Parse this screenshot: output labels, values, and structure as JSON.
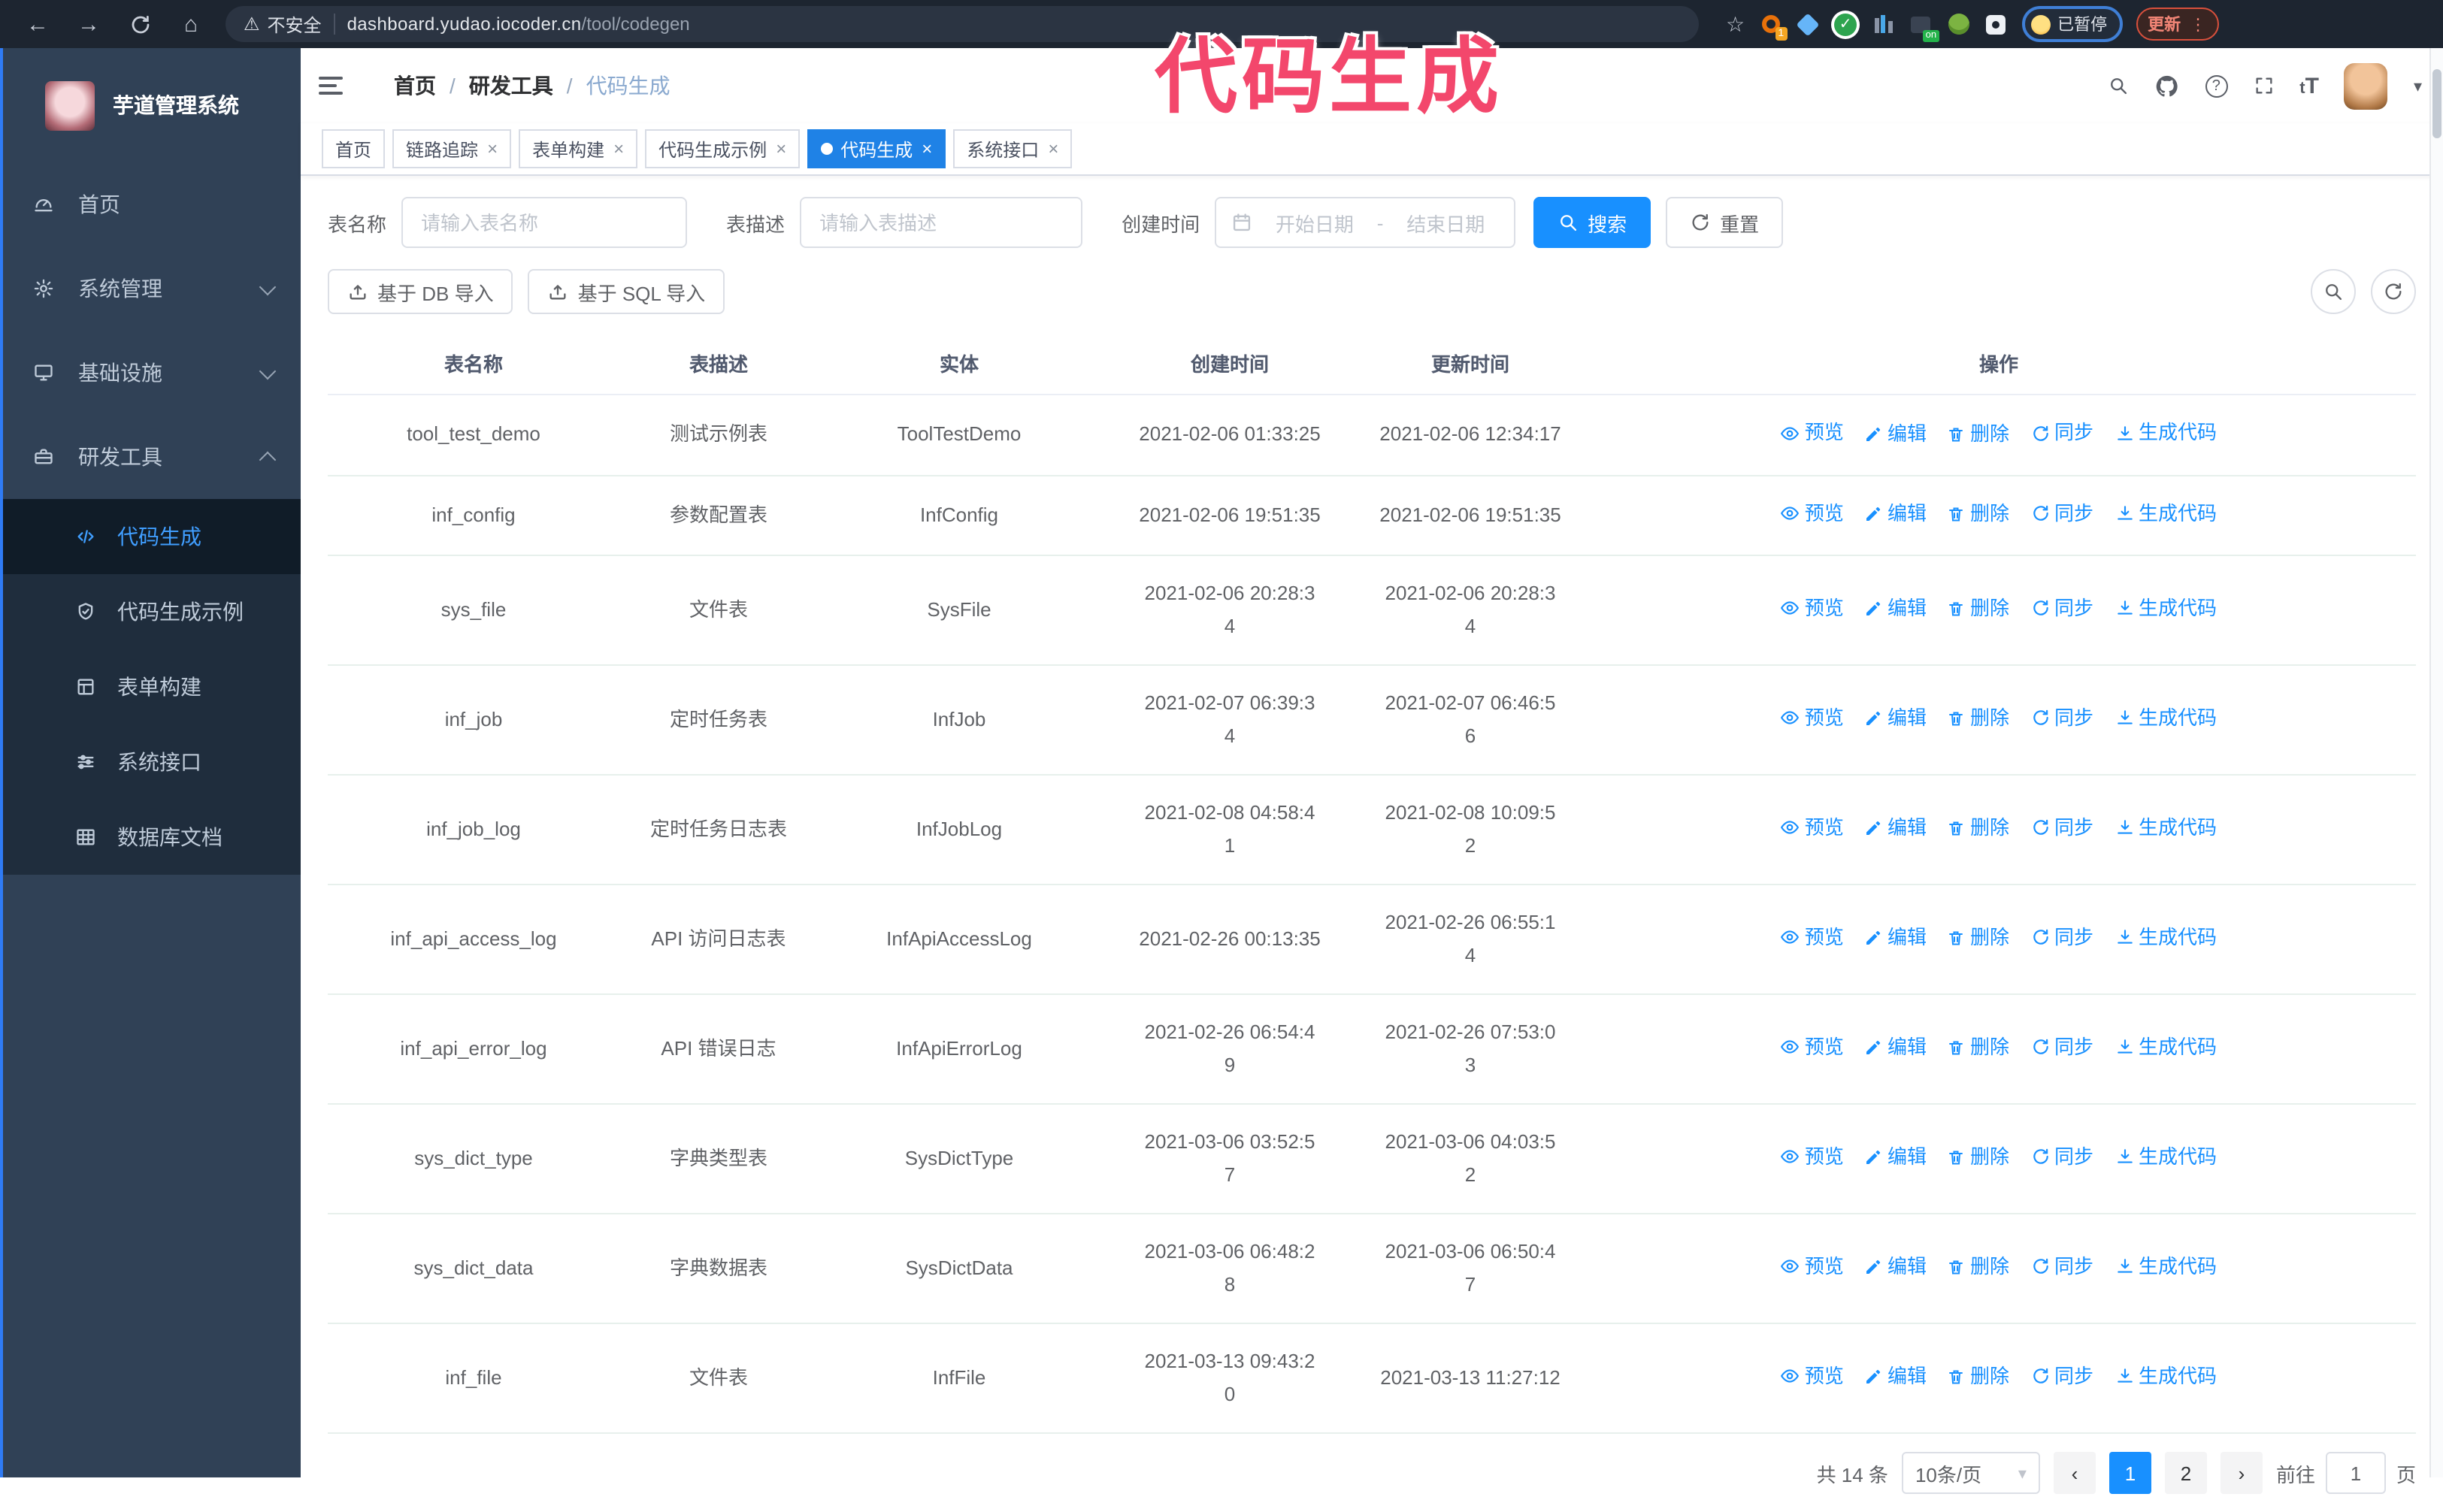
{
  "colors": {
    "accent": "#1890ff",
    "tag_active": "#1f82e6",
    "sidebar_bg": "#304156",
    "submenu_bg": "#1f2d3d",
    "annotation": "#f3476c",
    "chrome_bg": "#1d2530"
  },
  "annotation": {
    "text": "代码生成"
  },
  "browser": {
    "security_label": "不安全",
    "url_domain": "dashboard.yudao.iocoder.cn",
    "url_path": "/tool/codegen",
    "ext_badge_count": "1",
    "ext_on_label": "on",
    "paused_badge": "已暂停",
    "update_button": "更新",
    "menu_dots": "⋮"
  },
  "sidebar": {
    "title": "芋道管理系统",
    "items": [
      {
        "label": "首页",
        "icon": "dashboard-icon",
        "expand": ""
      },
      {
        "label": "系统管理",
        "icon": "gear-icon",
        "expand": "down"
      },
      {
        "label": "基础设施",
        "icon": "monitor-icon",
        "expand": "down"
      },
      {
        "label": "研发工具",
        "icon": "toolbox-icon",
        "expand": "up"
      }
    ],
    "subitems": [
      {
        "label": "代码生成",
        "icon": "code-icon",
        "active": true
      },
      {
        "label": "代码生成示例",
        "icon": "shield-check-icon",
        "active": false
      },
      {
        "label": "表单构建",
        "icon": "form-icon",
        "active": false
      },
      {
        "label": "系统接口",
        "icon": "sliders-icon",
        "active": false
      },
      {
        "label": "数据库文档",
        "icon": "table-icon",
        "active": false
      }
    ]
  },
  "header": {
    "breadcrumb": [
      "首页",
      "研发工具",
      "代码生成"
    ],
    "separator": "/"
  },
  "tabs": [
    {
      "label": "首页",
      "closable": false,
      "active": false
    },
    {
      "label": "链路追踪",
      "closable": true,
      "active": false
    },
    {
      "label": "表单构建",
      "closable": true,
      "active": false
    },
    {
      "label": "代码生成示例",
      "closable": true,
      "active": false
    },
    {
      "label": "代码生成",
      "closable": true,
      "active": true
    },
    {
      "label": "系统接口",
      "closable": true,
      "active": false
    }
  ],
  "filters": {
    "name_label": "表名称",
    "name_placeholder": "请输入表名称",
    "desc_label": "表描述",
    "desc_placeholder": "请输入表描述",
    "time_label": "创建时间",
    "start_placeholder": "开始日期",
    "range_separator": "-",
    "end_placeholder": "结束日期",
    "search_label": "搜索",
    "reset_label": "重置"
  },
  "toolbar": {
    "import_db_label": "基于 DB 导入",
    "import_sql_label": "基于 SQL 导入"
  },
  "table": {
    "columns": [
      "表名称",
      "表描述",
      "实体",
      "创建时间",
      "更新时间",
      "操作"
    ],
    "actions": [
      {
        "key": "preview",
        "label": "预览",
        "icon": "eye-icon"
      },
      {
        "key": "edit",
        "label": "编辑",
        "icon": "pencil-icon"
      },
      {
        "key": "delete",
        "label": "删除",
        "icon": "trash-icon"
      },
      {
        "key": "sync",
        "label": "同步",
        "icon": "sync-icon"
      },
      {
        "key": "generate",
        "label": "生成代码",
        "icon": "download-icon"
      }
    ],
    "rows": [
      {
        "name": "tool_test_demo",
        "desc": "测试示例表",
        "entity": "ToolTestDemo",
        "created": "2021-02-06 01:33:25",
        "created_wrap": false,
        "updated": "2021-02-06 12:34:17",
        "updated_wrap": false
      },
      {
        "name": "inf_config",
        "desc": "参数配置表",
        "entity": "InfConfig",
        "created": "2021-02-06 19:51:35",
        "created_wrap": false,
        "updated": "2021-02-06 19:51:35",
        "updated_wrap": false
      },
      {
        "name": "sys_file",
        "desc": "文件表",
        "entity": "SysFile",
        "created": "2021-02-06 20:28:34",
        "created_wrap": true,
        "updated": "2021-02-06 20:28:34",
        "updated_wrap": true
      },
      {
        "name": "inf_job",
        "desc": "定时任务表",
        "entity": "InfJob",
        "created": "2021-02-07 06:39:34",
        "created_wrap": true,
        "updated": "2021-02-07 06:46:56",
        "updated_wrap": true
      },
      {
        "name": "inf_job_log",
        "desc": "定时任务日志表",
        "entity": "InfJobLog",
        "created": "2021-02-08 04:58:41",
        "created_wrap": true,
        "updated": "2021-02-08 10:09:52",
        "updated_wrap": true
      },
      {
        "name": "inf_api_access_log",
        "desc": "API 访问日志表",
        "entity": "InfApiAccessLog",
        "created": "2021-02-26 00:13:35",
        "created_wrap": false,
        "updated": "2021-02-26 06:55:14",
        "updated_wrap": true
      },
      {
        "name": "inf_api_error_log",
        "desc": "API 错误日志",
        "entity": "InfApiErrorLog",
        "created": "2021-02-26 06:54:49",
        "created_wrap": true,
        "updated": "2021-02-26 07:53:03",
        "updated_wrap": true
      },
      {
        "name": "sys_dict_type",
        "desc": "字典类型表",
        "entity": "SysDictType",
        "created": "2021-03-06 03:52:57",
        "created_wrap": true,
        "updated": "2021-03-06 04:03:52",
        "updated_wrap": true
      },
      {
        "name": "sys_dict_data",
        "desc": "字典数据表",
        "entity": "SysDictData",
        "created": "2021-03-06 06:48:28",
        "created_wrap": true,
        "updated": "2021-03-06 06:50:47",
        "updated_wrap": true
      },
      {
        "name": "inf_file",
        "desc": "文件表",
        "entity": "InfFile",
        "created": "2021-03-13 09:43:20",
        "created_wrap": true,
        "updated": "2021-03-13 11:27:12",
        "updated_wrap": false
      }
    ]
  },
  "pagination": {
    "total": "共 14 条",
    "page_size": "10条/页",
    "pages": [
      "1",
      "2"
    ],
    "active_page": "1",
    "goto_label": "前往",
    "goto_value": "1",
    "page_label": "页"
  }
}
